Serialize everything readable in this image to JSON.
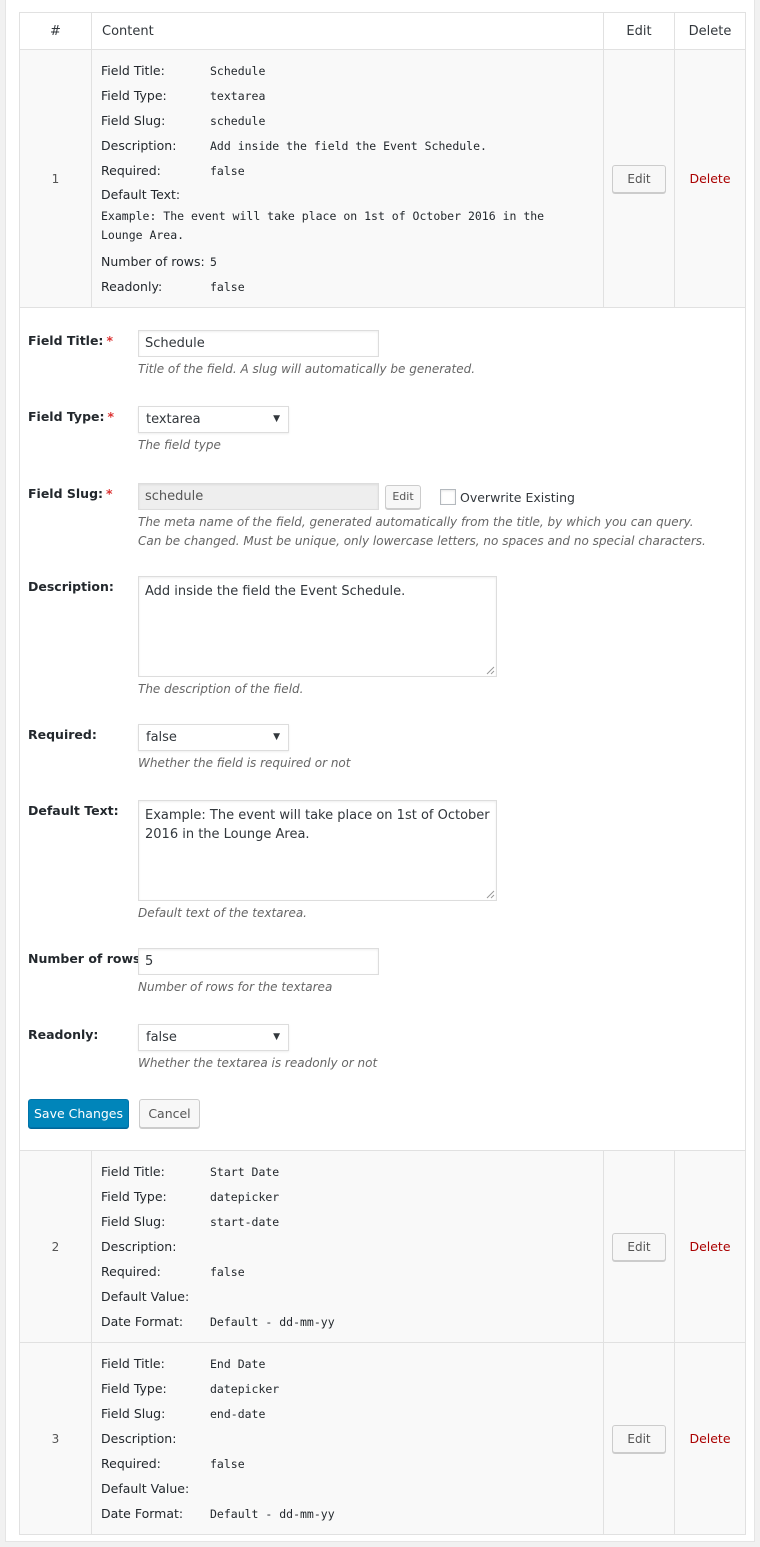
{
  "table": {
    "headers": {
      "num": "#",
      "content": "Content",
      "edit": "Edit",
      "delete": "Delete"
    },
    "edit_label": "Edit",
    "delete_label": "Delete",
    "rows": [
      {
        "num": "1",
        "fields": [
          {
            "key": "Field Title:",
            "value": "Schedule"
          },
          {
            "key": "Field Type:",
            "value": "textarea"
          },
          {
            "key": "Field Slug:",
            "value": "schedule"
          },
          {
            "key": "Description:",
            "value": "Add inside the field the Event Schedule."
          },
          {
            "key": "Required:",
            "value": "false"
          }
        ],
        "default_text": {
          "key": "Default Text:",
          "value": "Example: The event will take place on 1st of October 2016 in the Lounge Area."
        },
        "fields_after": [
          {
            "key": "Number of rows:",
            "value": "5"
          },
          {
            "key": "Readonly:",
            "value": "false"
          }
        ]
      },
      {
        "num": "2",
        "fields": [
          {
            "key": "Field Title:",
            "value": "Start Date"
          },
          {
            "key": "Field Type:",
            "value": "datepicker"
          },
          {
            "key": "Field Slug:",
            "value": "start-date"
          },
          {
            "key": "Description:",
            "value": ""
          },
          {
            "key": "Required:",
            "value": "false"
          },
          {
            "key": "Default Value:",
            "value": ""
          },
          {
            "key": "Date Format:",
            "value": "Default - dd-mm-yy"
          }
        ]
      },
      {
        "num": "3",
        "fields": [
          {
            "key": "Field Title:",
            "value": "End Date"
          },
          {
            "key": "Field Type:",
            "value": "datepicker"
          },
          {
            "key": "Field Slug:",
            "value": "end-date"
          },
          {
            "key": "Description:",
            "value": ""
          },
          {
            "key": "Required:",
            "value": "false"
          },
          {
            "key": "Default Value:",
            "value": ""
          },
          {
            "key": "Date Format:",
            "value": "Default - dd-mm-yy"
          }
        ]
      }
    ]
  },
  "form": {
    "required_mark": "*",
    "field_title": {
      "label": "Field Title:",
      "value": "Schedule",
      "help": "Title of the field. A slug will automatically be generated."
    },
    "field_type": {
      "label": "Field Type:",
      "value": "textarea",
      "help": "The field type"
    },
    "field_slug": {
      "label": "Field Slug:",
      "value": "schedule",
      "edit_label": "Edit",
      "overwrite_label": "Overwrite Existing",
      "help": "The meta name of the field, generated automatically from the title, by which you can query. Can be changed. Must be unique, only lowercase letters, no spaces and no special characters."
    },
    "description": {
      "label": "Description:",
      "value": "Add inside the field the Event Schedule.",
      "help": "The description of the field."
    },
    "required": {
      "label": "Required:",
      "value": "false",
      "help": "Whether the field is required or not"
    },
    "default_text": {
      "label": "Default Text:",
      "value": "Example: The event will take place on 1st of October 2016 in the Lounge Area.",
      "help": "Default text of the textarea."
    },
    "number_of_rows": {
      "label": "Number of rows:",
      "value": "5",
      "help": "Number of rows for the textarea"
    },
    "readonly": {
      "label": "Readonly:",
      "value": "false",
      "help": "Whether the textarea is readonly or not"
    },
    "save_label": "Save Changes",
    "cancel_label": "Cancel"
  },
  "icons": {
    "select_arrow": "triangle-down-icon",
    "resize_grip": "resize-grip-icon"
  }
}
